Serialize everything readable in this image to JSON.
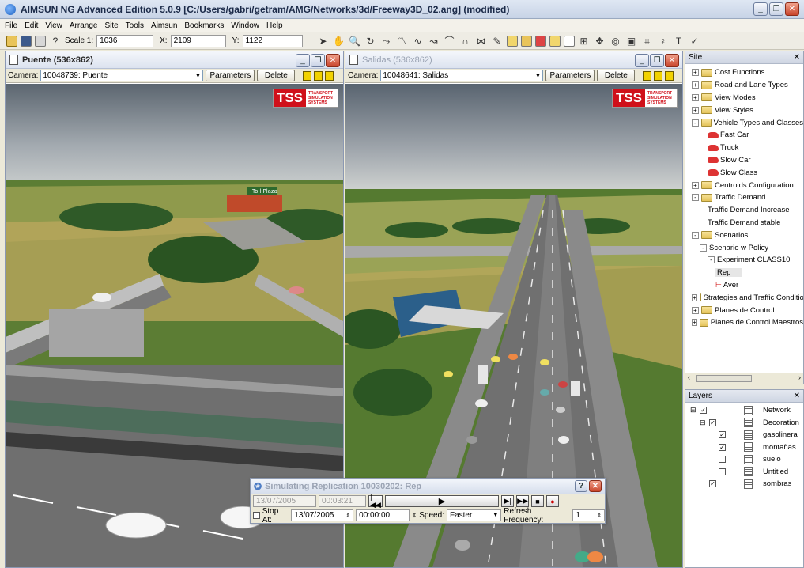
{
  "window": {
    "title": "AIMSUN NG Advanced Edition 5.0.9  [C:/Users/gabri/getram/AMG/Networks/3d/Freeway3D_02.ang] (modified)"
  },
  "menu": [
    "File",
    "Edit",
    "View",
    "Arrange",
    "Site",
    "Tools",
    "Aimsun",
    "Bookmarks",
    "Window",
    "Help"
  ],
  "toolbar": {
    "scale_label": "Scale 1:",
    "scale_value": "1036",
    "x_label": "X:",
    "x_value": "2109",
    "y_label": "Y:",
    "y_value": "1122"
  },
  "view_left": {
    "title": "Puente (536x862)",
    "camera_label": "Camera:",
    "camera_value": "10048739: Puente",
    "parameters_label": "Parameters",
    "delete_label": "Delete",
    "toll_sign": "Toll Plaza"
  },
  "view_right": {
    "title": "Salidas (536x862)",
    "camera_label": "Camera:",
    "camera_value": "10048641: Salidas",
    "parameters_label": "Parameters",
    "delete_label": "Delete"
  },
  "logo": {
    "text": "TSS",
    "subtitle": "TRANSPORT SIMULATION SYSTEMS"
  },
  "site_panel": {
    "title": "Site",
    "items": [
      {
        "label": "Cost Functions",
        "level": 0,
        "type": "folder",
        "expand": "+"
      },
      {
        "label": "Road and Lane Types",
        "level": 0,
        "type": "folder",
        "expand": "+"
      },
      {
        "label": "View Modes",
        "level": 0,
        "type": "folder",
        "expand": "+"
      },
      {
        "label": "View Styles",
        "level": 0,
        "type": "folder",
        "expand": "+"
      },
      {
        "label": "Vehicle Types and Classes",
        "level": 0,
        "type": "folder",
        "expand": "-"
      },
      {
        "label": "Fast Car",
        "level": 2,
        "type": "car",
        "expand": ""
      },
      {
        "label": "Truck",
        "level": 2,
        "type": "car",
        "expand": ""
      },
      {
        "label": "Slow Car",
        "level": 2,
        "type": "car",
        "expand": ""
      },
      {
        "label": "Slow Class",
        "level": 2,
        "type": "car",
        "expand": ""
      },
      {
        "label": "Centroids Configuration",
        "level": 0,
        "type": "folder",
        "expand": "+"
      },
      {
        "label": "Traffic Demand",
        "level": 0,
        "type": "folder",
        "expand": "-"
      },
      {
        "label": "Traffic Demand Increase",
        "level": 2,
        "type": "none",
        "expand": ""
      },
      {
        "label": "Traffic Demand stable",
        "level": 2,
        "type": "none",
        "expand": ""
      },
      {
        "label": "Scenarios",
        "level": 0,
        "type": "folder",
        "expand": "-"
      },
      {
        "label": "Scenario w Policy",
        "level": 1,
        "type": "none",
        "expand": "-"
      },
      {
        "label": "Experiment CLASS10",
        "level": 2,
        "type": "none",
        "expand": "-"
      },
      {
        "label": "Rep",
        "level": 3,
        "type": "none",
        "expand": ""
      },
      {
        "label": "Aver",
        "level": 3,
        "type": "aver",
        "expand": ""
      },
      {
        "label": "Strategies and Traffic Conditions",
        "level": 0,
        "type": "folder",
        "expand": "+"
      },
      {
        "label": "Planes de Control",
        "level": 0,
        "type": "folder",
        "expand": "+"
      },
      {
        "label": "Planes de Control Maestros",
        "level": 0,
        "type": "folder",
        "expand": "+"
      }
    ]
  },
  "layers_panel": {
    "title": "Layers",
    "items": [
      {
        "label": "Network",
        "indent": 0,
        "checked": true,
        "expand": "-"
      },
      {
        "label": "Decoration",
        "indent": 1,
        "checked": true,
        "expand": "-"
      },
      {
        "label": "gasolinera",
        "indent": 2,
        "checked": true,
        "expand": ""
      },
      {
        "label": "montañas",
        "indent": 2,
        "checked": true,
        "expand": ""
      },
      {
        "label": "suelo",
        "indent": 2,
        "checked": false,
        "expand": ""
      },
      {
        "label": "Untitled",
        "indent": 2,
        "checked": false,
        "expand": ""
      },
      {
        "label": "sombras",
        "indent": 1,
        "checked": true,
        "expand": ""
      }
    ]
  },
  "sim_dialog": {
    "title": "Simulating Replication 10030202: Rep",
    "date": "13/07/2005",
    "time": "00:03:21",
    "stop_at_label": "Stop At:",
    "stop_date": "13/07/2005",
    "stop_time": "00:00:00",
    "speed_label": "Speed:",
    "speed_value": "Faster",
    "refresh_label": "Refresh Frequency:",
    "refresh_value": "1"
  },
  "colors": {
    "accent": "#d0101a",
    "titlebar": "#c7d3e6"
  }
}
